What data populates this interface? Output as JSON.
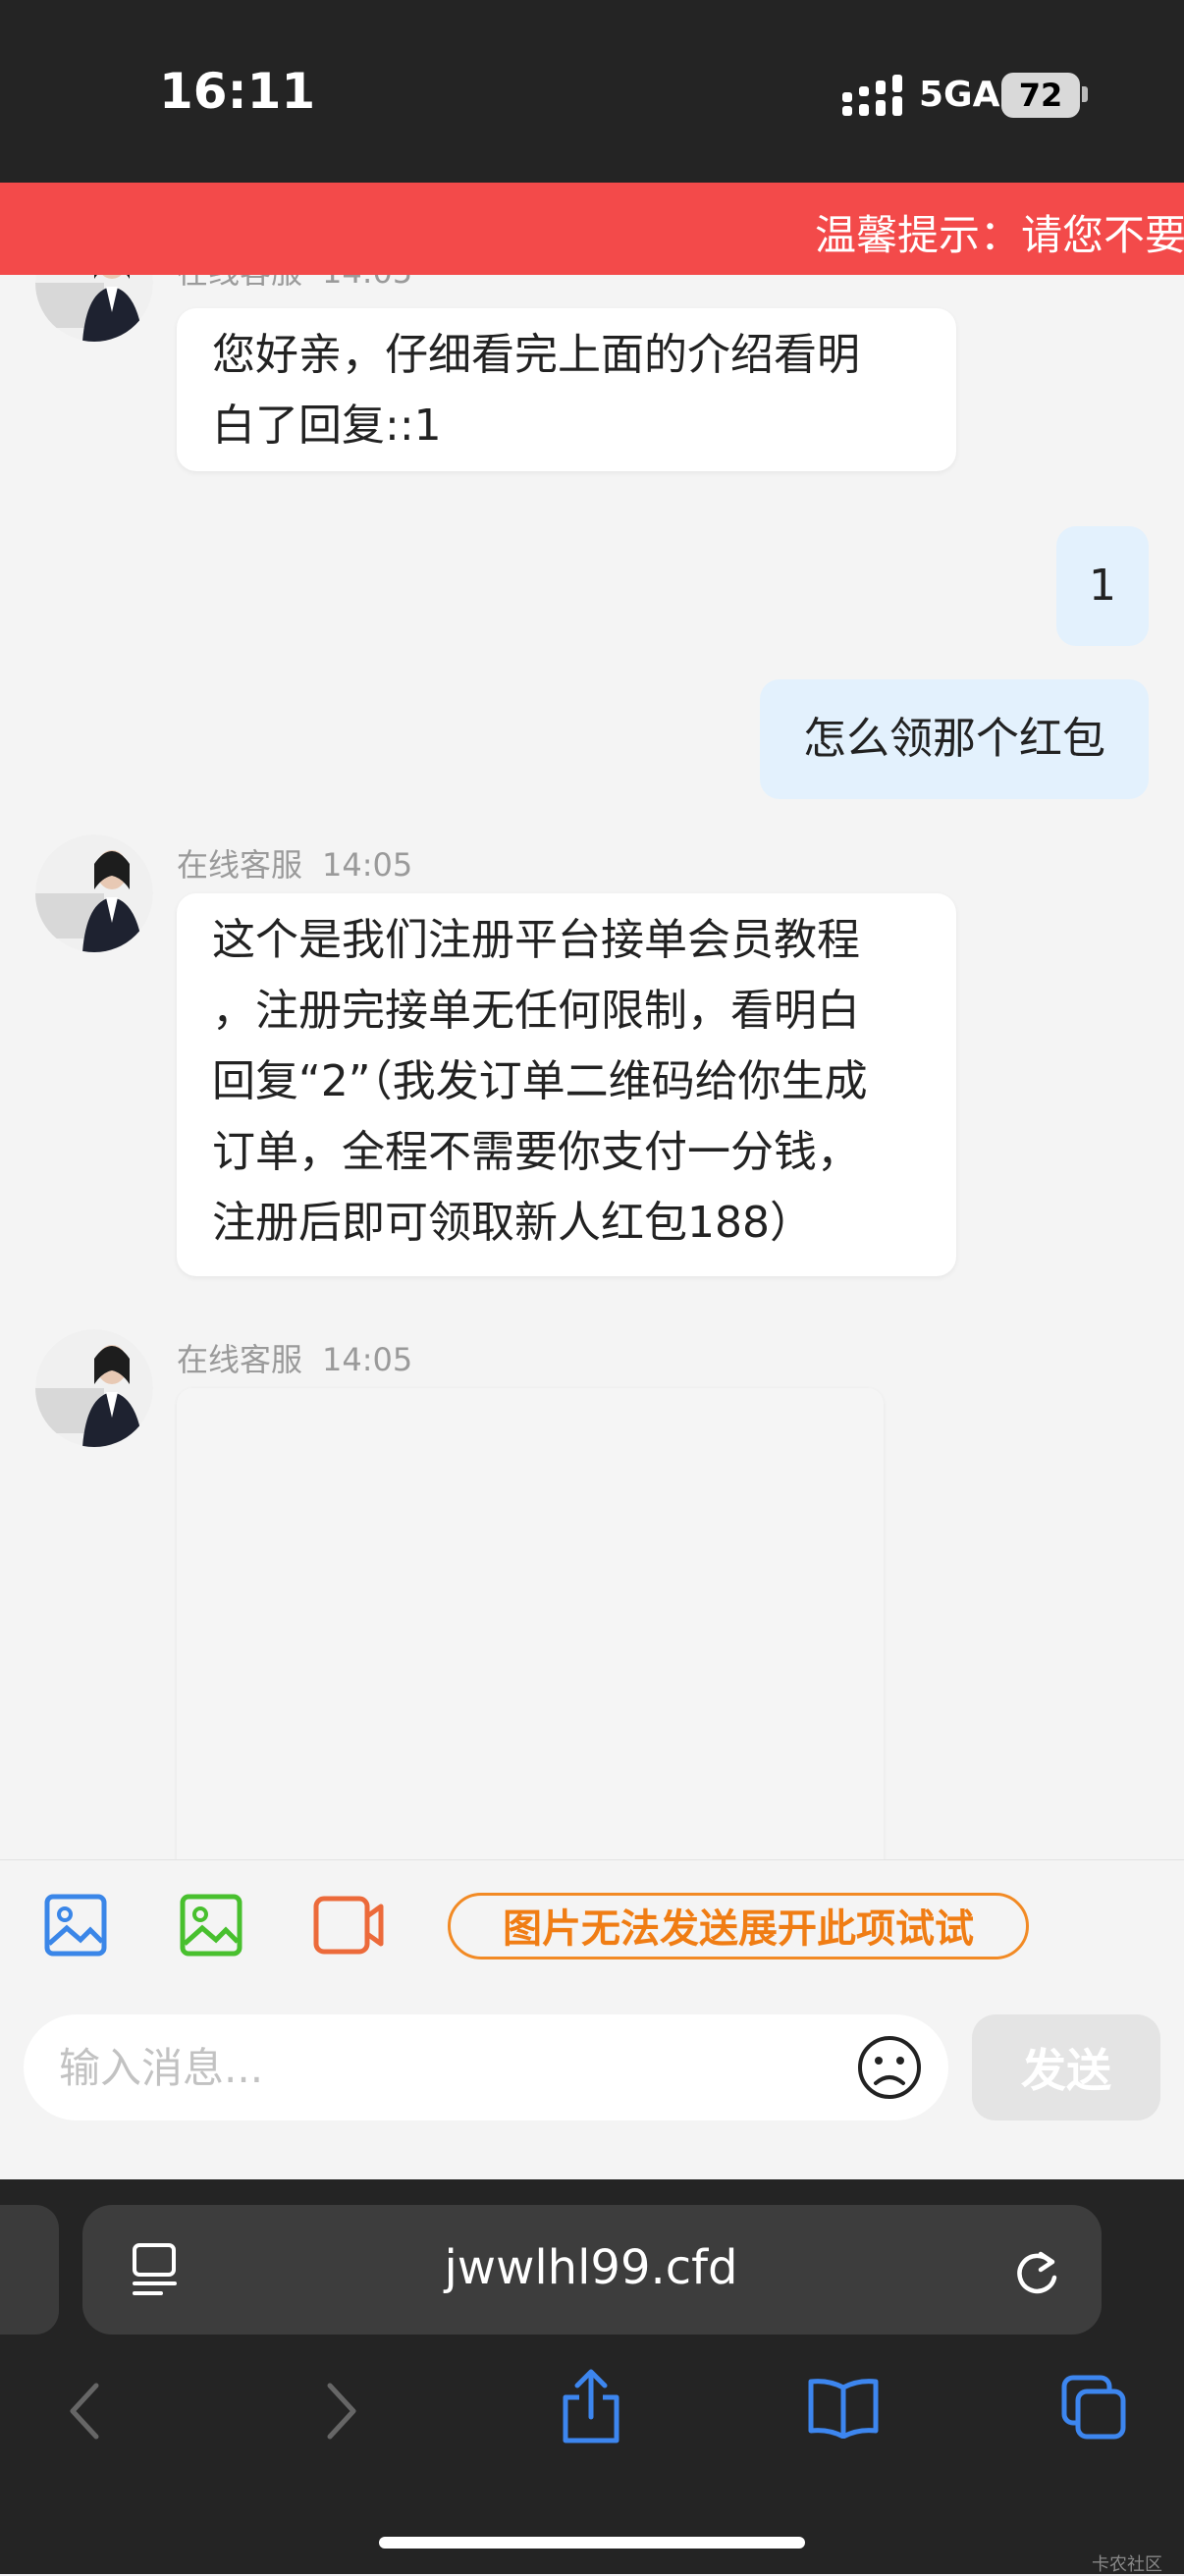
{
  "status_bar": {
    "time": "16:11",
    "network": "5GA",
    "battery": "72"
  },
  "notice": {
    "text": "温馨提示：请您不要"
  },
  "chat": {
    "partial_message": {
      "sender": "在线客服",
      "time": "14:05",
      "lines": [
        "您好亲，仔细看完上面的介绍看明",
        "白了回复::1"
      ]
    },
    "user_messages": [
      "1",
      "怎么领那个红包"
    ],
    "agent_message_1": {
      "sender": "在线客服",
      "time": "14:05",
      "lines": [
        "这个是我们注册平台接单会员教程",
        "，注册完接单无任何限制，看明白",
        "回复“2”（我发订单二维码给你生成",
        "订单，全程不需要你支付一分钱，",
        "注册后即可领取新人红包188）"
      ]
    },
    "agent_message_2": {
      "sender": "在线客服",
      "time": "14:05"
    }
  },
  "toolbar": {
    "tip_label": "图片无法发送展开此项试试"
  },
  "input": {
    "placeholder": "输入消息...",
    "value": "",
    "send_label": "发送"
  },
  "browser": {
    "url": "jwwlhl99.cfd"
  },
  "watermark": "卡农社区",
  "icons": {
    "toolbar": [
      "image-icon",
      "gallery-icon",
      "video-icon"
    ],
    "input": [
      "emoji-icon"
    ],
    "browser": [
      "tabs-menu-icon",
      "reload-icon",
      "back-icon",
      "forward-icon",
      "share-icon",
      "bookmarks-icon",
      "tabs-icon"
    ]
  },
  "colors": {
    "notice_bg": "#f34a4a",
    "tip_accent": "#f07d14",
    "user_bubble": "#e3f1fd",
    "browser_accent": "#3d86ef"
  }
}
